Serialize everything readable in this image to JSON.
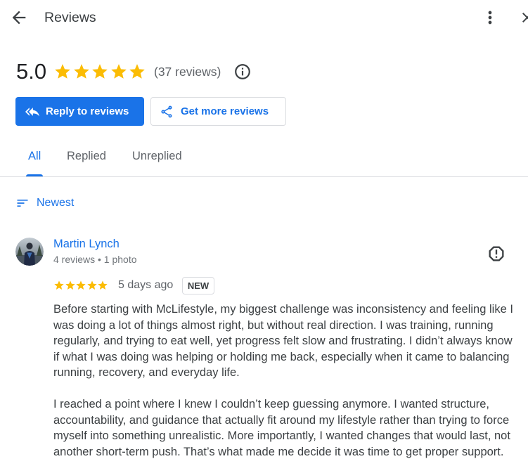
{
  "header": {
    "title": "Reviews",
    "back_icon": "arrow-back-icon",
    "more_icon": "more-vert-icon",
    "close_icon": "close-icon"
  },
  "summary": {
    "rating": "5.0",
    "stars": 5,
    "review_count": "(37 reviews)",
    "info_icon": "info-icon"
  },
  "actions": {
    "reply": {
      "label": "Reply to reviews",
      "icon": "reply-all-icon"
    },
    "get_more": {
      "label": "Get more reviews",
      "icon": "share-icon"
    }
  },
  "tabs": [
    {
      "label": "All",
      "active": true
    },
    {
      "label": "Replied",
      "active": false
    },
    {
      "label": "Unreplied",
      "active": false
    }
  ],
  "sort": {
    "label": "Newest",
    "icon": "sort-icon"
  },
  "reviews": [
    {
      "author": "Martin Lynch",
      "author_meta": "4 reviews • 1 photo",
      "rating": 5,
      "time": "5 days ago",
      "badge": "NEW",
      "report_icon": "report-icon",
      "paragraphs": [
        "Before starting with McLifestyle, my biggest challenge was inconsistency and feeling like I was doing a lot of things almost right, but without real direction. I was training, running regularly, and trying to eat well, yet progress felt slow and frustrating. I didn’t always know if what I was doing was helping or holding me back, especially when it came to balancing running, recovery, and everyday life.",
        "I reached a point where I knew I couldn’t keep guessing anymore. I wanted structure, accountability, and guidance that actually fit around my lifestyle rather than trying to force myself into something unrealistic. More importantly, I wanted changes that would last, not another short-term push. That’s what made me decide it was time to get proper support."
      ]
    }
  ],
  "colors": {
    "accent": "#1a73e8",
    "star": "#fbbc04",
    "text": "#3c4043",
    "muted": "#70757a",
    "divider": "#dadce0"
  }
}
